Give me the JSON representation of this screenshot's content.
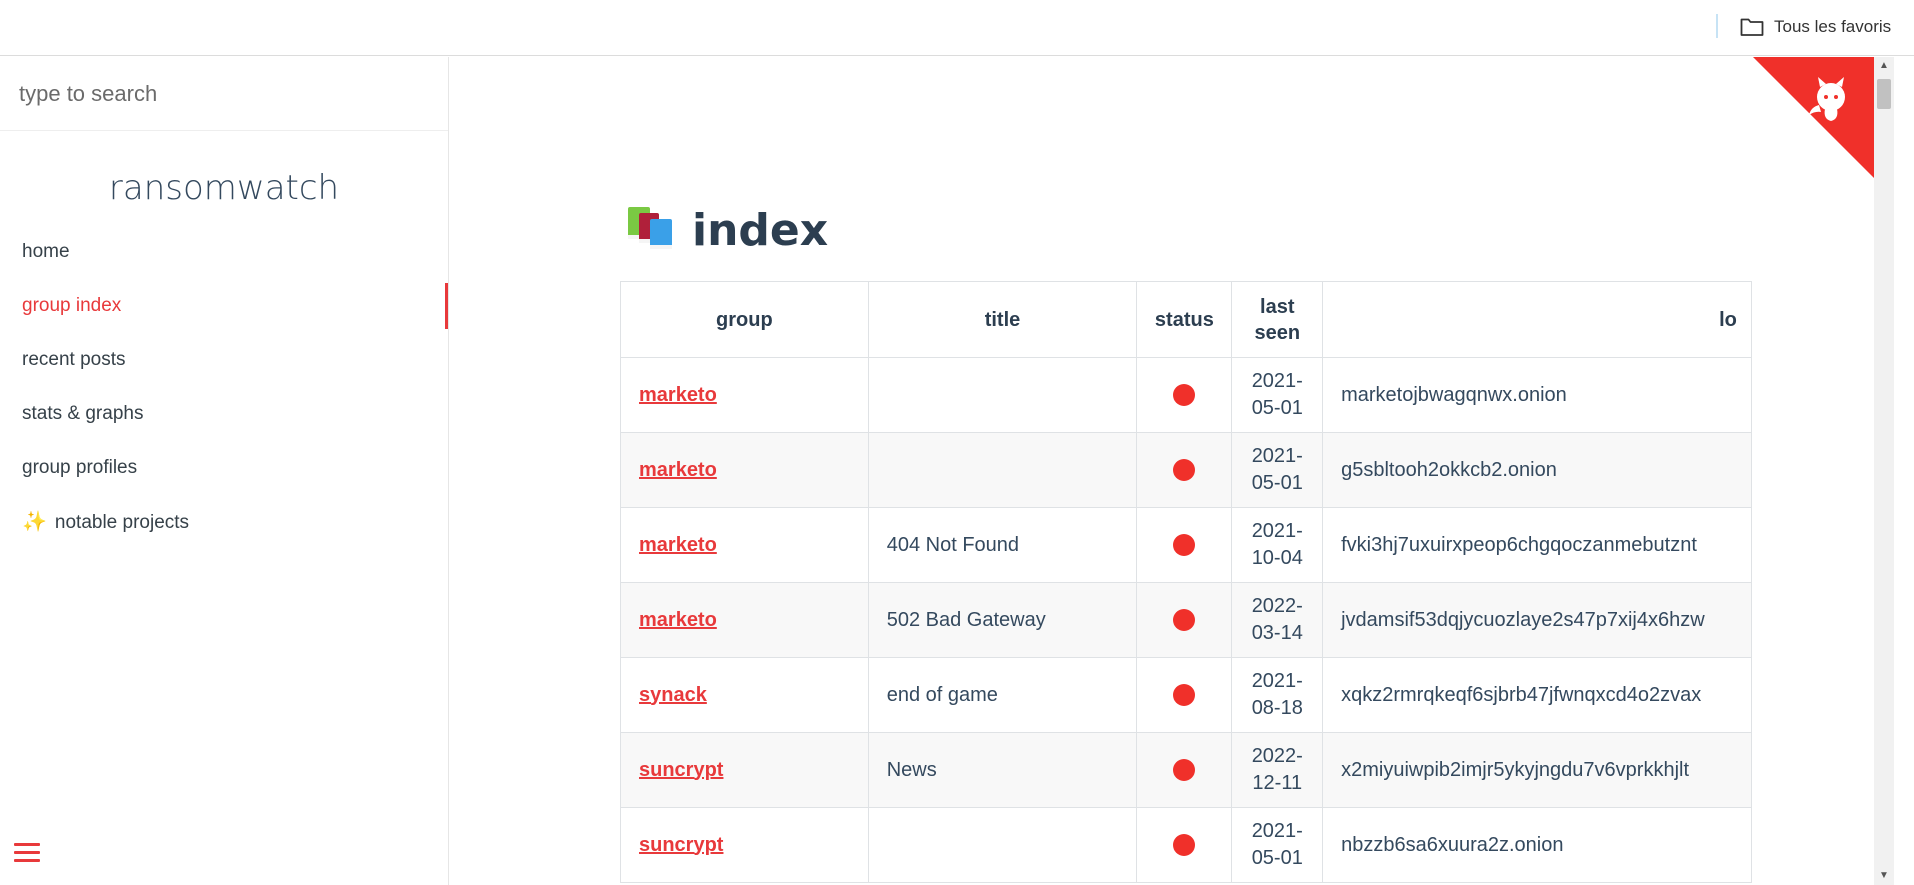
{
  "browser": {
    "favorites_label": "Tous les favoris"
  },
  "sidebar": {
    "search_placeholder": "type to search",
    "app_name": "ransomwatch",
    "items": [
      {
        "label": "home",
        "active": false
      },
      {
        "label": "group index",
        "active": true
      },
      {
        "label": "recent posts",
        "active": false
      },
      {
        "label": "stats & graphs",
        "active": false
      },
      {
        "label": "group profiles",
        "active": false
      },
      {
        "label": "notable projects",
        "active": false,
        "icon": "sparkles-icon"
      }
    ]
  },
  "main": {
    "title": "index",
    "title_icon": "books-icon",
    "table": {
      "headers": [
        "group",
        "title",
        "status",
        "last seen",
        "lo"
      ],
      "rows": [
        {
          "group": "marketo",
          "title": "",
          "status": "offline",
          "last_seen": "2021-05-01",
          "location": "marketojbwagqnwx.onion"
        },
        {
          "group": "marketo",
          "title": "",
          "status": "offline",
          "last_seen": "2021-05-01",
          "location": "g5sbltooh2okkcb2.onion"
        },
        {
          "group": "marketo",
          "title": "404 Not Found",
          "status": "offline",
          "last_seen": "2021-10-04",
          "location": "fvki3hj7uxuirxpeop6chgqoczanmebutznt"
        },
        {
          "group": "marketo",
          "title": "502 Bad Gateway",
          "status": "offline",
          "last_seen": "2022-03-14",
          "location": "jvdamsif53dqjycuozlaye2s47p7xij4x6hzw"
        },
        {
          "group": "synack",
          "title": "end of game",
          "status": "offline",
          "last_seen": "2021-08-18",
          "location": "xqkz2rmrqkeqf6sjbrb47jfwnqxcd4o2zvax"
        },
        {
          "group": "suncrypt",
          "title": "News",
          "status": "offline",
          "last_seen": "2022-12-11",
          "location": "x2miyuiwpib2imjr5ykyjngdu7v6vprkkhjlt"
        },
        {
          "group": "suncrypt",
          "title": "",
          "status": "offline",
          "last_seen": "2021-05-01",
          "location": "nbzzb6sa6xuura2z.onion"
        }
      ]
    }
  },
  "colors": {
    "accent": "#e8393b",
    "status_offline": "#f0302a",
    "text": "#34495e"
  }
}
